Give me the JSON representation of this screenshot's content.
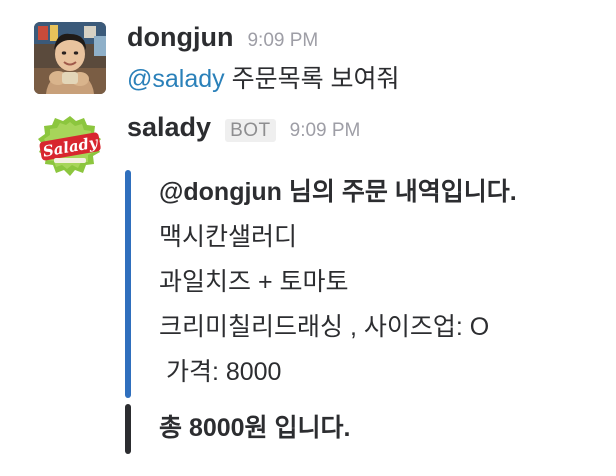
{
  "colors": {
    "mention": "#2a80b9",
    "attachment_bar_blue": "#2f6fbd",
    "attachment_bar_dark": "#2c2d30"
  },
  "messages": [
    {
      "username": "dongjun",
      "time": "9:09 PM",
      "mention": "@salady",
      "text": " 주문목록 보여줘"
    },
    {
      "username": "salady",
      "badge": "BOT",
      "time": "9:09 PM",
      "avatar_logo_text": "Salady",
      "attachments": [
        {
          "lines": [
            "@dongjun 님의 주문 내역입니다.",
            "맥시칸샐러디",
            "과일치즈  +  토마토",
            "크리미칠리드래싱 , 사이즈업: O",
            " 가격: 8000"
          ]
        },
        {
          "lines": [
            "총 8000원 입니다."
          ]
        }
      ]
    }
  ]
}
